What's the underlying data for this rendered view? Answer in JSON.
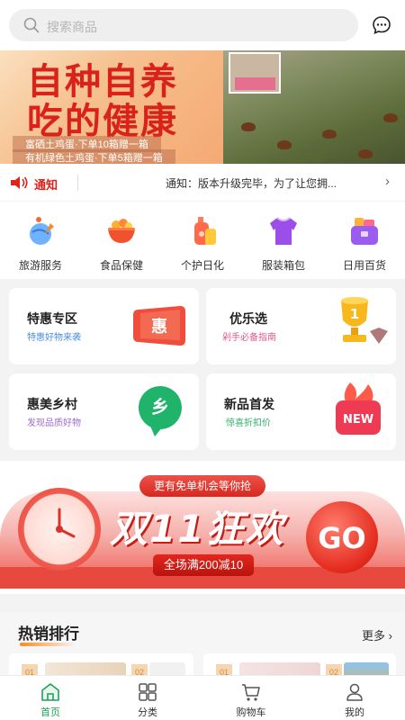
{
  "search": {
    "placeholder": "搜索商品"
  },
  "banner": {
    "title_line1": "自种自养",
    "title_line2": "吃的健康",
    "line1": "富硒土鸡蛋·下单10箱赠一箱",
    "line2": "有机绿色土鸡蛋·下单5箱赠一箱"
  },
  "notice": {
    "label": "通知",
    "text": "通知：版本升级完毕，为了让您拥..."
  },
  "categories": [
    {
      "label": "旅游服务",
      "icon": "travel-globe-icon"
    },
    {
      "label": "食品保健",
      "icon": "food-bowl-icon"
    },
    {
      "label": "个护日化",
      "icon": "care-bottle-icon"
    },
    {
      "label": "服装箱包",
      "icon": "clothing-icon"
    },
    {
      "label": "日用百货",
      "icon": "daily-goods-icon"
    }
  ],
  "cards": [
    {
      "title": "特惠专区",
      "subtitle": "特惠好物来袭",
      "badge": "惠",
      "subtitle_color": "#4a8fe0"
    },
    {
      "title": "优乐选",
      "subtitle": "剁手必备指南",
      "badge": "1",
      "subtitle_color": "#e05a8a"
    },
    {
      "title": "惠美乡村",
      "subtitle": "发现品质好物",
      "badge": "乡",
      "subtitle_color": "#a06cd5"
    },
    {
      "title": "新品首发",
      "subtitle": "惊喜折扣价",
      "badge": "NEW",
      "subtitle_color": "#2fb36a"
    }
  ],
  "promo": {
    "pill": "更有免单机会等你抢",
    "title": "双11狂欢",
    "subtitle": "全场满200减10",
    "go": "GO"
  },
  "hot": {
    "title": "热销排行",
    "more": "更多",
    "ranks": [
      "01",
      "02",
      "01",
      "02"
    ]
  },
  "tabs": [
    {
      "label": "首页",
      "icon": "home-icon",
      "active": true
    },
    {
      "label": "分类",
      "icon": "category-icon",
      "active": false
    },
    {
      "label": "购物车",
      "icon": "cart-icon",
      "active": false
    },
    {
      "label": "我的",
      "icon": "user-icon",
      "active": false
    }
  ],
  "colors": {
    "accent": "#22a05a",
    "notice_red": "#e2221b",
    "promo_red": "#e8493f"
  }
}
